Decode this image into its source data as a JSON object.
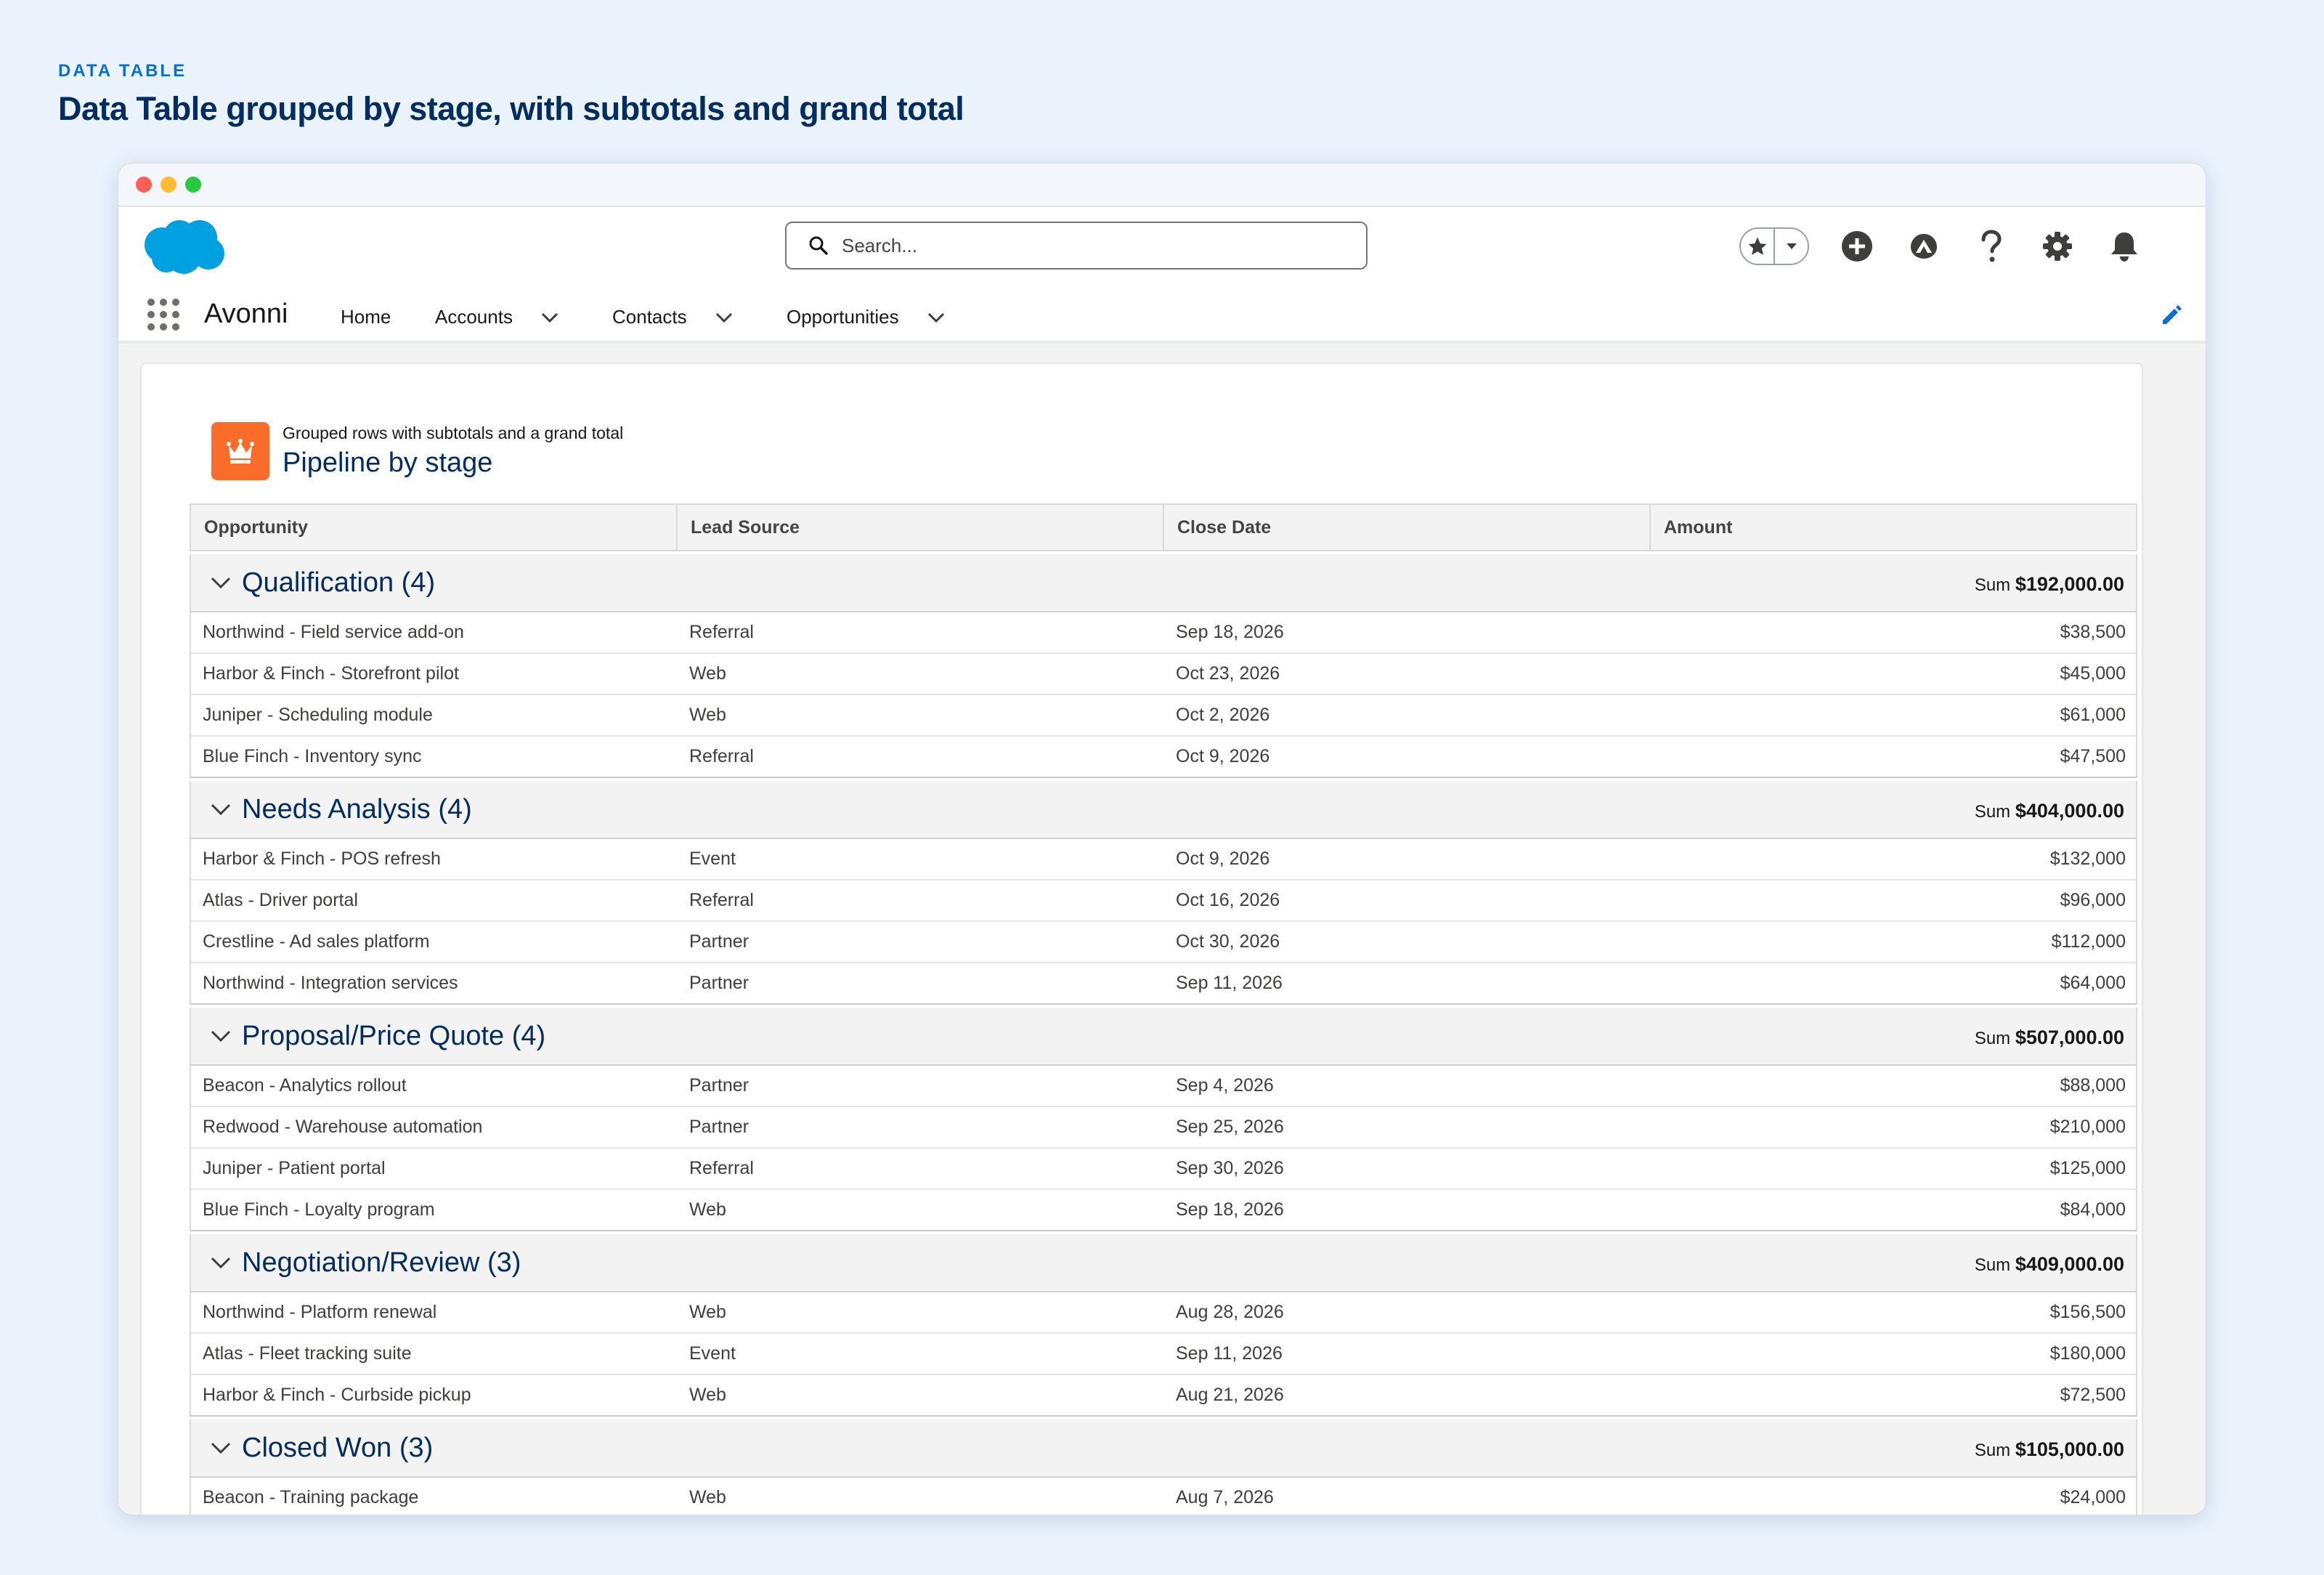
{
  "hero": {
    "eyebrow": "DATA TABLE",
    "title": "Data Table grouped by stage, with subtotals and grand total"
  },
  "header": {
    "search_placeholder": "Search...",
    "icons": [
      "star-icon",
      "chevron-down-icon",
      "add-icon",
      "trailhead-icon",
      "help-icon",
      "gear-icon",
      "bell-icon"
    ]
  },
  "nav": {
    "app_name": "Avonni",
    "items": [
      {
        "label": "Home",
        "has_menu": false
      },
      {
        "label": "Accounts",
        "has_menu": true
      },
      {
        "label": "Contacts",
        "has_menu": true
      },
      {
        "label": "Opportunities",
        "has_menu": true
      }
    ]
  },
  "card": {
    "subtitle": "Grouped rows with subtotals and a grand total",
    "title": "Pipeline by stage",
    "icon_color": "#f96c2a"
  },
  "table": {
    "columns": [
      "Opportunity",
      "Lead Source",
      "Close Date",
      "Amount"
    ],
    "sum_label": "Sum",
    "groups": [
      {
        "title": "Qualification (4)",
        "sum": "$192,000.00",
        "rows": [
          [
            "Northwind - Field service add-on",
            "Referral",
            "Sep 18, 2026",
            "$38,500"
          ],
          [
            "Harbor & Finch - Storefront pilot",
            "Web",
            "Oct 23, 2026",
            "$45,000"
          ],
          [
            "Juniper - Scheduling module",
            "Web",
            "Oct 2, 2026",
            "$61,000"
          ],
          [
            "Blue Finch - Inventory sync",
            "Referral",
            "Oct 9, 2026",
            "$47,500"
          ]
        ]
      },
      {
        "title": "Needs Analysis (4)",
        "sum": "$404,000.00",
        "rows": [
          [
            "Harbor & Finch - POS refresh",
            "Event",
            "Oct 9, 2026",
            "$132,000"
          ],
          [
            "Atlas - Driver portal",
            "Referral",
            "Oct 16, 2026",
            "$96,000"
          ],
          [
            "Crestline - Ad sales platform",
            "Partner",
            "Oct 30, 2026",
            "$112,000"
          ],
          [
            "Northwind - Integration services",
            "Partner",
            "Sep 11, 2026",
            "$64,000"
          ]
        ]
      },
      {
        "title": "Proposal/Price Quote (4)",
        "sum": "$507,000.00",
        "rows": [
          [
            "Beacon - Analytics rollout",
            "Partner",
            "Sep 4, 2026",
            "$88,000"
          ],
          [
            "Redwood - Warehouse automation",
            "Partner",
            "Sep 25, 2026",
            "$210,000"
          ],
          [
            "Juniper - Patient portal",
            "Referral",
            "Sep 30, 2026",
            "$125,000"
          ],
          [
            "Blue Finch - Loyalty program",
            "Web",
            "Sep 18, 2026",
            "$84,000"
          ]
        ]
      },
      {
        "title": "Negotiation/Review (3)",
        "sum": "$409,000.00",
        "rows": [
          [
            "Northwind - Platform renewal",
            "Web",
            "Aug 28, 2026",
            "$156,500"
          ],
          [
            "Atlas - Fleet tracking suite",
            "Event",
            "Sep 11, 2026",
            "$180,000"
          ],
          [
            "Harbor & Finch - Curbside pickup",
            "Web",
            "Aug 21, 2026",
            "$72,500"
          ]
        ]
      },
      {
        "title": "Closed Won (3)",
        "sum": "$105,000.00",
        "rows": [
          [
            "Beacon - Training package",
            "Web",
            "Aug 7, 2026",
            "$24,000"
          ]
        ]
      }
    ]
  },
  "colors": {
    "brand_blue": "#032d60",
    "accent": "#0b6fd1",
    "salesforce_cloud": "#00a1e0"
  }
}
